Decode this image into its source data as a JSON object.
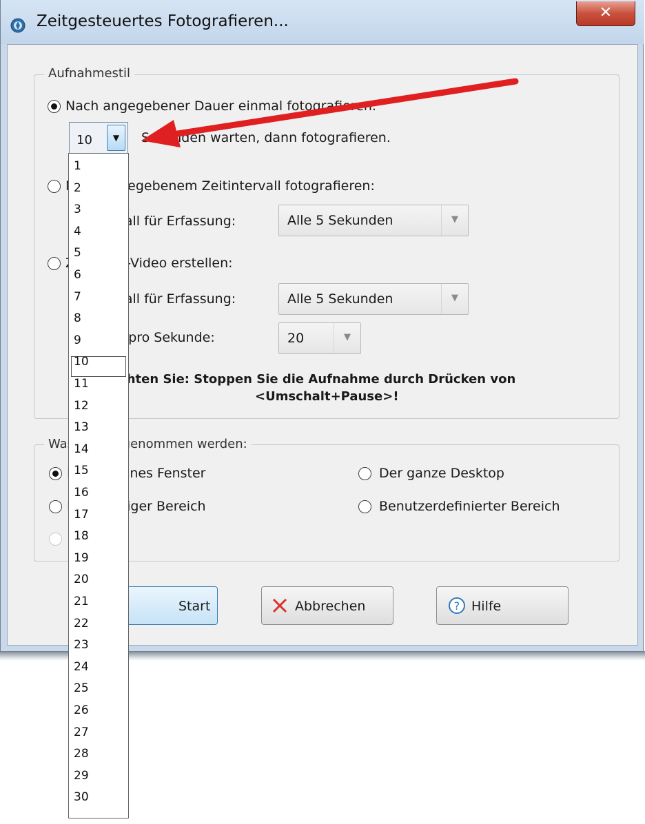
{
  "window": {
    "title": "Zeitgesteuertes Fotografieren...",
    "close_glyph": "✕"
  },
  "style_group": {
    "legend": "Aufnahmestil",
    "opt1_label": "Nach angegebener Dauer einmal fotografieren.",
    "seconds_value": "10",
    "seconds_suffix": "Sekunden warten, dann fotografieren.",
    "opt2_label": "Nach angegebenem Zeitintervall fotografieren:",
    "opt2_interval_label": "Intervall für Erfassung:",
    "opt2_interval_value": "Alle 5 Sekunden",
    "opt3_label": "Zeitraffer-Video erstellen:",
    "opt3_interval_label": "Intervall für Erfassung:",
    "opt3_interval_value": "Alle 5 Sekunden",
    "opt3_fps_label": "Bilder pro Sekunde:",
    "opt3_fps_value": "20",
    "note_line1": "Beachten Sie: Stoppen Sie die Aufnahme durch Drücken von",
    "note_line2": "<Umschalt+Pause>!"
  },
  "capture_group": {
    "legend": "Was soll aufgenommen werden:",
    "single_window": "Ein einzelnes Fenster",
    "whole_desktop": "Der ganze Desktop",
    "rectangle": "Rechteckiger Bereich",
    "custom_area": "Benutzerdefinierter Bereich"
  },
  "buttons": {
    "start": "Start",
    "cancel": "Abbrechen",
    "help": "Hilfe"
  },
  "dropdown": {
    "items": [
      "1",
      "2",
      "3",
      "4",
      "5",
      "6",
      "7",
      "8",
      "9",
      "10",
      "11",
      "12",
      "13",
      "14",
      "15",
      "16",
      "17",
      "18",
      "19",
      "20",
      "21",
      "22",
      "23",
      "24",
      "25",
      "26",
      "27",
      "28",
      "29",
      "30"
    ],
    "selected": "10"
  },
  "annotation": {
    "arrow_color": "#e02020"
  },
  "icons": {
    "app": "camera-shutter-icon",
    "close": "close-icon",
    "cancel": "x-icon",
    "help": "question-icon"
  }
}
